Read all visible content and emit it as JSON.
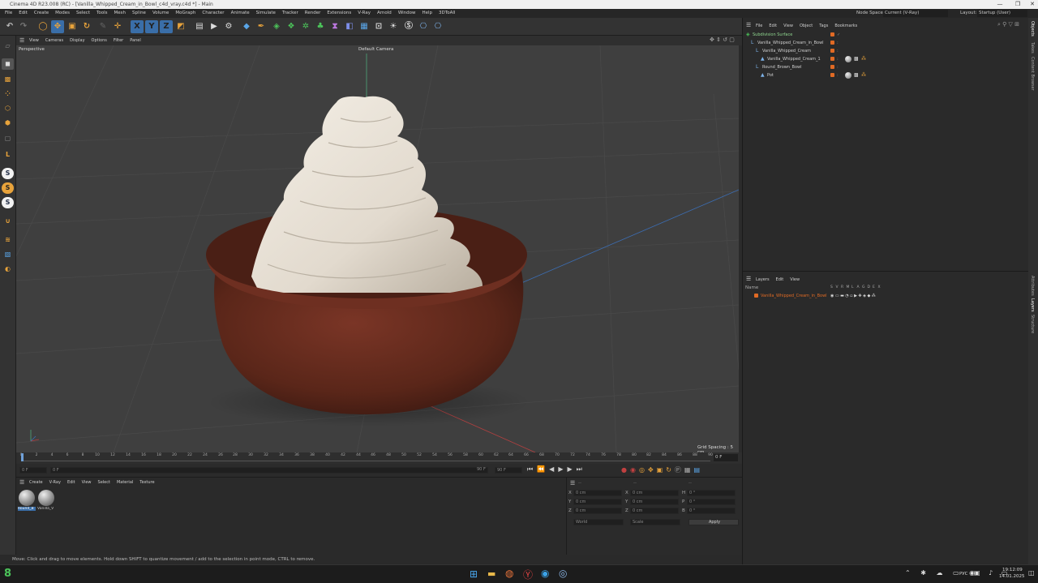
{
  "window": {
    "title": "Cinema 4D R23.008 (RC) - [Vanilla_Whipped_Cream_in_Bowl_c4d_vray.c4d *] - Main",
    "controls": [
      "—",
      "❐",
      "✕"
    ]
  },
  "menubar": {
    "items": [
      "File",
      "Edit",
      "Create",
      "Modes",
      "Select",
      "Tools",
      "Mesh",
      "Spline",
      "Volume",
      "MoGraph",
      "Character",
      "Animate",
      "Simulate",
      "Tracker",
      "Render",
      "Extensions",
      "V-Ray",
      "Arnold",
      "Window",
      "Help",
      "3DToAll"
    ],
    "node_space_label": "Node Space:",
    "node_space_value": "Current (V-Ray)",
    "layout_label": "Layout:",
    "layout_value": "Startup (User)"
  },
  "viewport": {
    "menu": [
      "View",
      "Cameras",
      "Display",
      "Options",
      "Filter",
      "Panel"
    ],
    "label": "Perspective",
    "camera": "Default Camera",
    "grid_spacing": "Grid Spacing : 5 cm"
  },
  "timeline": {
    "ticks": [
      "0",
      "2",
      "4",
      "6",
      "8",
      "10",
      "12",
      "14",
      "16",
      "18",
      "20",
      "22",
      "24",
      "26",
      "28",
      "30",
      "32",
      "34",
      "36",
      "38",
      "40",
      "42",
      "44",
      "46",
      "48",
      "50",
      "52",
      "54",
      "56",
      "58",
      "60",
      "62",
      "64",
      "66",
      "68",
      "70",
      "72",
      "74",
      "76",
      "78",
      "80",
      "82",
      "84",
      "86",
      "88",
      "90"
    ],
    "current_frame": "0 F"
  },
  "transport": {
    "start": "0 F",
    "start2": "0 F",
    "end": "90 F",
    "end2": "90 F"
  },
  "materials": {
    "menu": [
      "Create",
      "V-Ray",
      "Edit",
      "View",
      "Select",
      "Material",
      "Texture"
    ],
    "items": [
      {
        "name": "Round_B"
      },
      {
        "name": "Vanilla_V"
      }
    ]
  },
  "coords": {
    "rows": [
      {
        "a": "X",
        "a_val": "0 cm",
        "b": "X",
        "b_val": "0 cm",
        "c": "H",
        "c_val": "0 °"
      },
      {
        "a": "Y",
        "a_val": "0 cm",
        "b": "Y",
        "b_val": "0 cm",
        "c": "P",
        "c_val": "0 °"
      },
      {
        "a": "Z",
        "a_val": "0 cm",
        "b": "Z",
        "b_val": "0 cm",
        "c": "B",
        "c_val": "0 °"
      }
    ],
    "world": "World",
    "scale": "Scale",
    "apply": "Apply",
    "header_a": "--",
    "header_b": "--",
    "header_c": "--"
  },
  "objects": {
    "menu": [
      "File",
      "Edit",
      "View",
      "Object",
      "Tags",
      "Bookmarks"
    ],
    "rows": [
      {
        "name": "Subdivision Surface",
        "indent": 0
      },
      {
        "name": "Vanilla_Whipped_Cream_in_Bowl",
        "indent": 1
      },
      {
        "name": "Vanilla_Whipped_Cream",
        "indent": 2
      },
      {
        "name": "Vanilla_Whipped_Cream_1",
        "indent": 3
      },
      {
        "name": "Round_Brown_Bowl",
        "indent": 2
      },
      {
        "name": "Pot",
        "indent": 3
      }
    ]
  },
  "layers": {
    "menu": [
      "Layers",
      "Edit",
      "View"
    ],
    "name_header": "Name",
    "flags": [
      "S",
      "V",
      "R",
      "M",
      "L",
      "A",
      "G",
      "D",
      "E",
      "X"
    ],
    "rows": [
      {
        "name": "Vanilla_Whipped_Cream_in_Bowl"
      }
    ]
  },
  "side_tabs": [
    "Objects",
    "Takes",
    "Content Browser",
    "Attributes",
    "Layers",
    "Structure"
  ],
  "status": "Move: Click and drag to move elements. Hold down SHIFT to quantize movement / add to the selection in point mode, CTRL to remove.",
  "taskbar": {
    "lang": "РУС",
    "time": "19:12:09",
    "date": "14.01.2025"
  },
  "colors": {
    "accent": "#e06a24",
    "select": "#3a6ea8",
    "bowl": "#6b2e22",
    "cream": "#e9e3d9"
  }
}
